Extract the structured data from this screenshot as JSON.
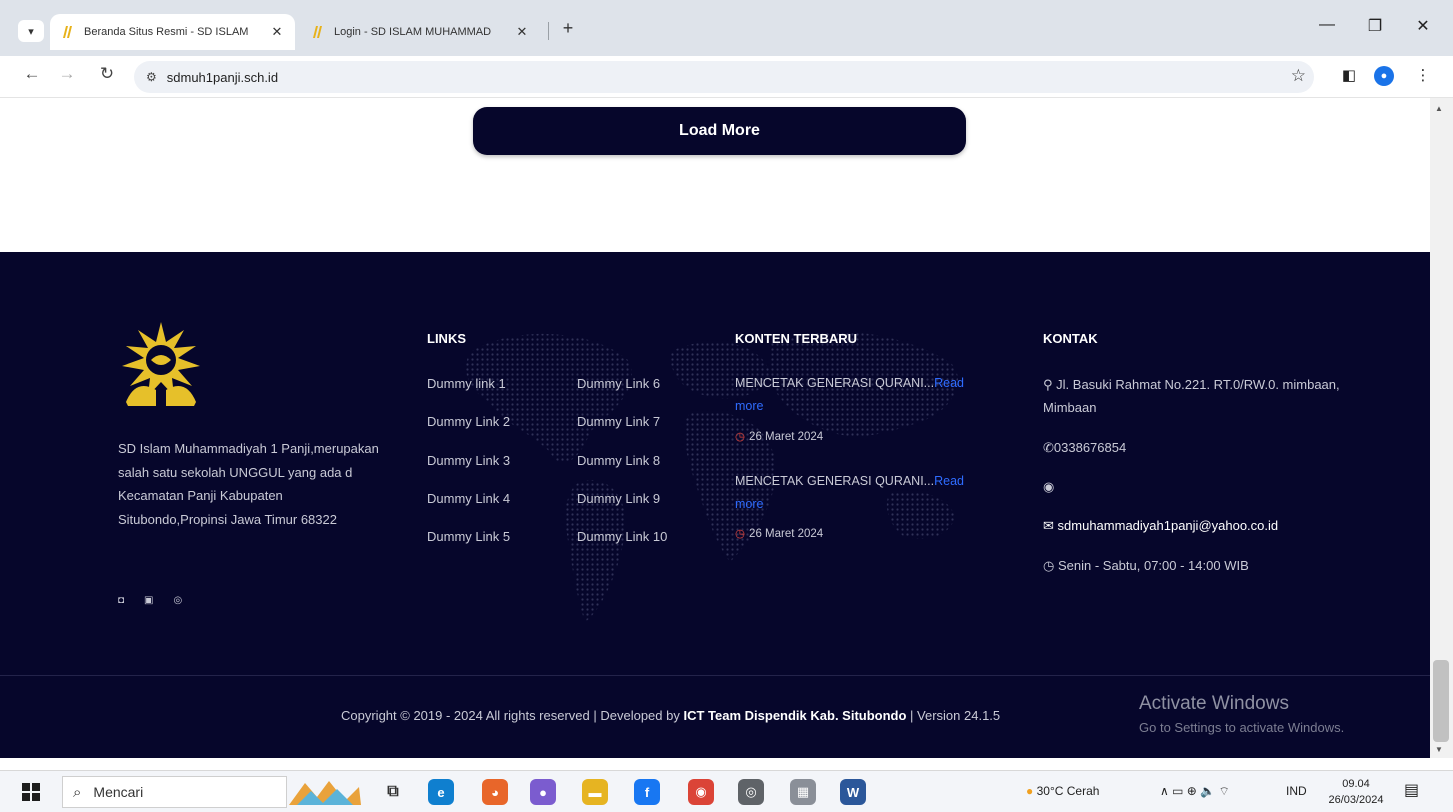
{
  "browser": {
    "tabs": [
      {
        "title": "Beranda Situs Resmi - SD ISLAM",
        "active": true
      },
      {
        "title": "Login - SD ISLAM MUHAMMAD",
        "active": false
      }
    ],
    "address": "sdmuh1panji.sch.id",
    "icons": {
      "dropdown": "▾",
      "close": "✕",
      "new_tab": "+",
      "minimize": "—",
      "restore": "❐",
      "win_close": "✕",
      "back": "←",
      "forward": "→",
      "reload": "↻",
      "site_info": "⚙",
      "star": "☆",
      "sidepanel": "◧",
      "menu": "⋮",
      "profile": "●"
    }
  },
  "page": {
    "load_more_label": "Load More",
    "scroll_up": "▲",
    "scroll_down": "▼"
  },
  "footer": {
    "about": "SD Islam Muhammadiyah 1 Panji,merupakan salah satu sekolah UNGGUL yang ada d Kecamatan Panji Kabupaten Situbondo,Propinsi Jawa Timur 68322",
    "social_icons": [
      "◘",
      "▣",
      "◎"
    ],
    "links_title": "LINKS",
    "links": [
      "Dummy link 1",
      "Dummy Link 2",
      "Dummy Link 3",
      "Dummy Link 4",
      "Dummy Link 5",
      "Dummy Link 6",
      "Dummy Link 7",
      "Dummy Link 8",
      "Dummy Link 9",
      "Dummy Link 10"
    ],
    "news_title": "KONTEN TERBARU",
    "posts": [
      {
        "title": "MENCETAK GENERASI QURANI...",
        "read_more": "Read more",
        "date": "26 Maret 2024"
      },
      {
        "title": "MENCETAK GENERASI QURANI...",
        "read_more": "Read more",
        "date": "26 Maret 2024"
      }
    ],
    "contact_title": "KONTAK",
    "contact": {
      "address": "Jl. Basuki Rahmat No.221. RT.0/RW.0. mimbaan, Mimbaan",
      "phone": "0338676854",
      "email": "sdmuhammadiyah1panji@yahoo.co.id",
      "hours": "Senin - Sabtu, 07:00 - 14:00 WIB"
    },
    "contact_icons": {
      "address": "⚲",
      "phone": "✆",
      "web": "◉",
      "email": "✉",
      "hours": "◷"
    },
    "copyright_prefix": "Copyright © 2019 - 2024 All rights reserved | Developed by ",
    "copyright_dev": "ICT Team Dispendik Kab. Situbondo",
    "copyright_suffix": " | Version 24.1.5"
  },
  "watermark": {
    "title": "Activate Windows",
    "subtitle": "Go to Settings to activate Windows."
  },
  "taskbar": {
    "search_placeholder": "Mencari",
    "search_icon": "⌕",
    "task_view_icon": "⧉",
    "weather": "30°C Cerah",
    "tray_icons": "∧  ▭  ⊕  🔈  ⌔",
    "language": "IND",
    "time": "09.04",
    "date": "26/03/2024",
    "notification_icon": "▤",
    "apps": [
      {
        "name": "edge",
        "color": "#0f7fcf",
        "glyph": "e"
      },
      {
        "name": "firefox",
        "color": "#e8662a",
        "glyph": "◕"
      },
      {
        "name": "teams",
        "color": "#7b5ccf",
        "glyph": "●"
      },
      {
        "name": "files",
        "color": "#e6b422",
        "glyph": "▬"
      },
      {
        "name": "facebook",
        "color": "#1877f2",
        "glyph": "f"
      },
      {
        "name": "chrome",
        "color": "#db4437",
        "glyph": "◉"
      },
      {
        "name": "chrome-profile",
        "color": "#5f6368",
        "glyph": "◎"
      },
      {
        "name": "photos",
        "color": "#8a8f98",
        "glyph": "▦"
      },
      {
        "name": "word",
        "color": "#2b579a",
        "glyph": "W"
      }
    ]
  }
}
